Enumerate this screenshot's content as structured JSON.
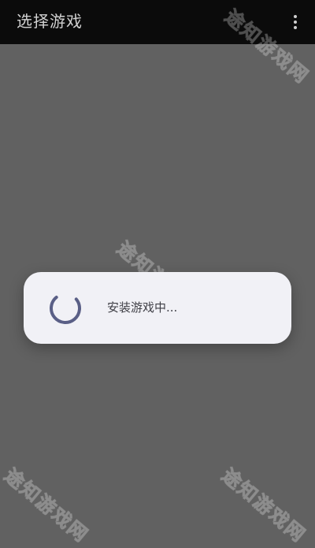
{
  "app_bar": {
    "title": "选择游戏",
    "menu_icon": "more-vert-icon"
  },
  "dialog": {
    "message": "安装游戏中...",
    "spinner_icon": "loading-spinner-icon",
    "spinner_color": "#5a5f86"
  },
  "watermarks": [
    "途知游戏网",
    "途知游戏网",
    "途知游戏网",
    "途知游戏网"
  ],
  "colors": {
    "app_bar_bg": "#0b0b0b",
    "scrim": "#616161",
    "dialog_bg": "#f1f1f6"
  }
}
